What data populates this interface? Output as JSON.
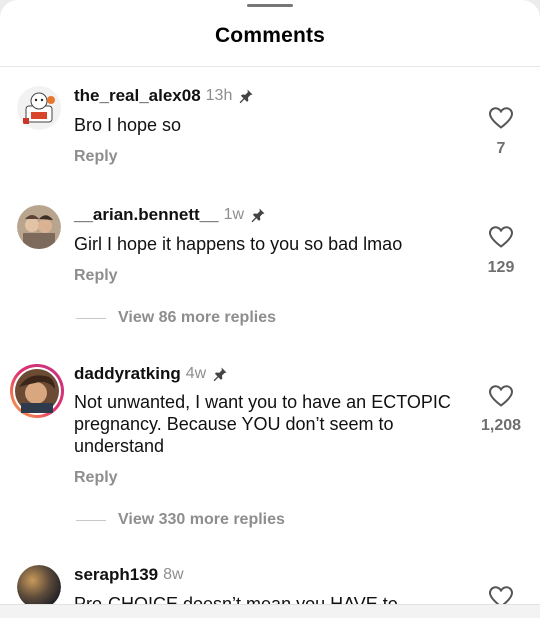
{
  "header": {
    "title": "Comments"
  },
  "comments": [
    {
      "username": "the_real_alex08",
      "time": "13h",
      "text": "Bro I hope so",
      "reply_label": "Reply",
      "likes": "7"
    },
    {
      "username": "__arian.bennett__",
      "time": "1w",
      "text": "Girl I hope it happens to you so bad lmao",
      "reply_label": "Reply",
      "likes": "129",
      "more_replies": "View 86 more replies"
    },
    {
      "username": "daddyratking",
      "time": "4w",
      "text": "Not unwanted, I want you to have an ECTOPIC pregnancy. Because YOU don’t seem to understand",
      "reply_label": "Reply",
      "likes": "1,208",
      "more_replies": "View 330 more replies"
    },
    {
      "username": "seraph139",
      "time": "8w",
      "text": "Pro-CHOICE doesn’t mean you HAVE to"
    }
  ],
  "icons": {
    "pin": "pushpin-icon",
    "heart": "heart-outline-icon"
  },
  "colors": {
    "story_ring_start": "#c13584",
    "story_ring_end": "#fcaf45",
    "muted_text": "#8e8e8e"
  }
}
